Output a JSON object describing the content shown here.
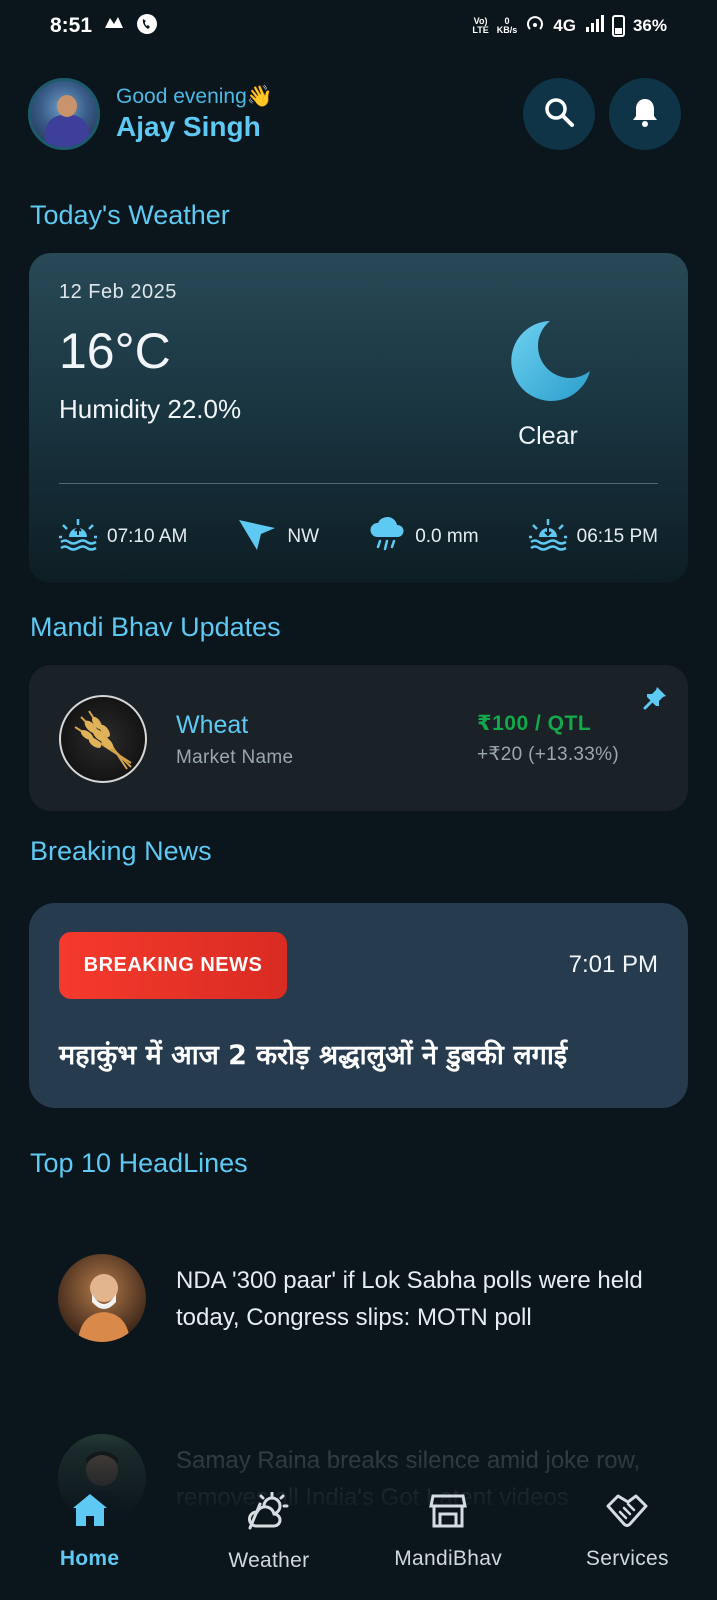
{
  "status_bar": {
    "time": "8:51",
    "net_top": "Vo)",
    "net_bottom": "LTE",
    "speed_top": "0",
    "speed_bottom": "KB/s",
    "network": "4G",
    "battery": "36%"
  },
  "header": {
    "greeting": "Good evening👋",
    "user_name": "Ajay Singh"
  },
  "weather": {
    "section_title": "Today's Weather",
    "date": "12 Feb 2025",
    "temperature": "16°C",
    "humidity": "Humidity 22.0%",
    "condition": "Clear",
    "sunrise": "07:10 AM",
    "wind_direction": "NW",
    "rain": "0.0 mm",
    "sunset": "06:15 PM"
  },
  "mandi": {
    "section_title": "Mandi Bhav Updates",
    "crop": "Wheat",
    "market": "Market Name",
    "price": "₹100 / QTL",
    "change": "+₹20 (+13.33%)"
  },
  "breaking": {
    "section_title": "Breaking News",
    "badge": "BREAKING NEWS",
    "time": "7:01 PM",
    "headline": "महाकुंभ में आज 2 करोड़ श्रद्धालुओं ने डुबकी लगाई"
  },
  "headlines": {
    "section_title": "Top 10 HeadLines",
    "items": [
      {
        "text": "NDA '300 paar' if Lok Sabha polls were held today, Congress slips: MOTN poll"
      },
      {
        "text": "Samay Raina breaks silence amid joke row, removes all India's Got Latent videos"
      }
    ]
  },
  "nav": {
    "home": "Home",
    "weather": "Weather",
    "mandibhav": "MandiBhav",
    "services": "Services"
  },
  "colors": {
    "accent": "#5ec9f2",
    "background": "#0b151c",
    "price_green": "#13a84a",
    "breaking_red": "#f53a2c"
  }
}
